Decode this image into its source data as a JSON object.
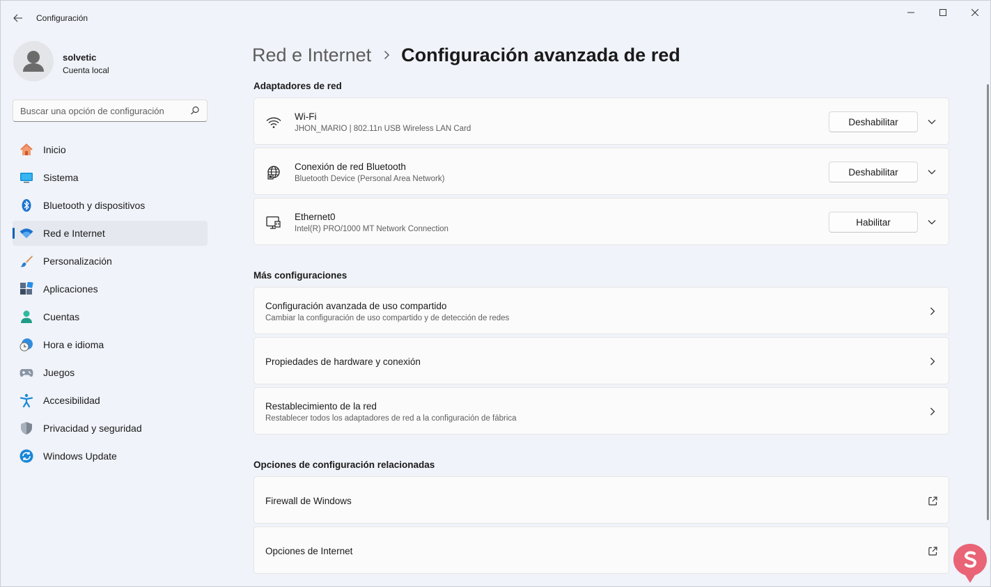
{
  "app": {
    "title": "Configuración"
  },
  "profile": {
    "name": "solvetic",
    "account_type": "Cuenta local"
  },
  "search": {
    "placeholder": "Buscar una opción de configuración"
  },
  "sidebar": {
    "items": [
      {
        "label": "Inicio",
        "icon": "home-icon",
        "active": false
      },
      {
        "label": "Sistema",
        "icon": "system-icon",
        "active": false
      },
      {
        "label": "Bluetooth y dispositivos",
        "icon": "bluetooth-icon",
        "active": false
      },
      {
        "label": "Red e Internet",
        "icon": "wifi-icon",
        "active": true
      },
      {
        "label": "Personalización",
        "icon": "brush-icon",
        "active": false
      },
      {
        "label": "Aplicaciones",
        "icon": "apps-icon",
        "active": false
      },
      {
        "label": "Cuentas",
        "icon": "account-icon",
        "active": false
      },
      {
        "label": "Hora e idioma",
        "icon": "clock-globe-icon",
        "active": false
      },
      {
        "label": "Juegos",
        "icon": "gamepad-icon",
        "active": false
      },
      {
        "label": "Accesibilidad",
        "icon": "accessibility-icon",
        "active": false
      },
      {
        "label": "Privacidad y seguridad",
        "icon": "shield-icon",
        "active": false
      },
      {
        "label": "Windows Update",
        "icon": "update-icon",
        "active": false
      }
    ]
  },
  "breadcrumb": {
    "parent": "Red e Internet",
    "current": "Configuración avanzada de red"
  },
  "sections": {
    "adapters": {
      "title": "Adaptadores de red",
      "items": [
        {
          "name": "Wi-Fi",
          "detail": "JHON_MARIO | 802.11n USB Wireless LAN Card",
          "button": "Deshabilitar",
          "icon": "wifi-icon"
        },
        {
          "name": "Conexión de red Bluetooth",
          "detail": "Bluetooth Device (Personal Area Network)",
          "button": "Deshabilitar",
          "icon": "globe-network-icon"
        },
        {
          "name": "Ethernet0",
          "detail": "Intel(R) PRO/1000 MT Network Connection",
          "button": "Habilitar",
          "icon": "ethernet-icon"
        }
      ]
    },
    "more": {
      "title": "Más configuraciones",
      "items": [
        {
          "title": "Configuración avanzada de uso compartido",
          "subtitle": "Cambiar la configuración de uso compartido y de detección de redes"
        },
        {
          "title": "Propiedades de hardware y conexión",
          "subtitle": ""
        },
        {
          "title": "Restablecimiento de la red",
          "subtitle": "Restablecer todos los adaptadores de red a la configuración de fábrica"
        }
      ]
    },
    "related": {
      "title": "Opciones de configuración relacionadas",
      "items": [
        {
          "title": "Firewall de Windows"
        },
        {
          "title": "Opciones de Internet"
        }
      ]
    }
  },
  "colors": {
    "accent": "#005fb8",
    "background": "#f0f3f9",
    "card": "#fbfbfc"
  }
}
